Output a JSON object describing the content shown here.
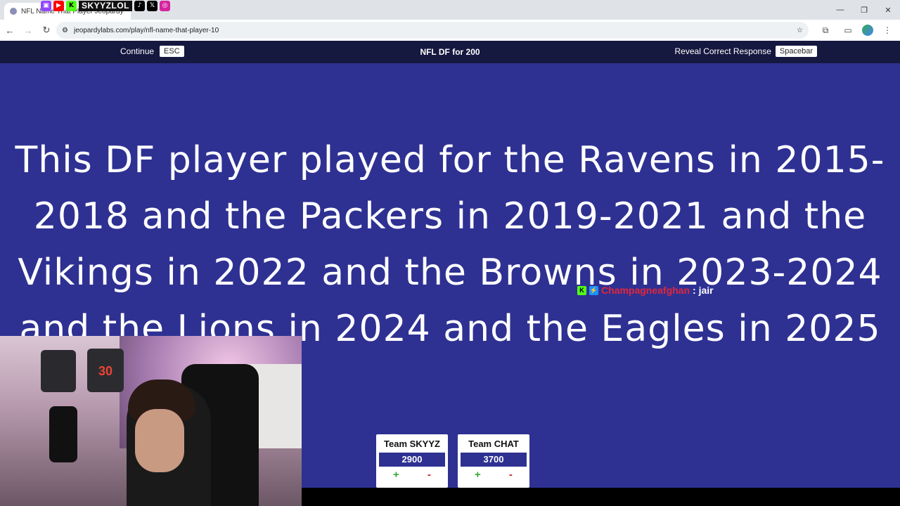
{
  "browser": {
    "tab_title": "NFL Name That Player Jeopardy",
    "url": "jeopardylabs.com/play/nfl-name-that-player-10",
    "overlay_brand": "SKYYZLOL",
    "window_controls": [
      "minimize-icon",
      "restore-icon",
      "close-icon"
    ]
  },
  "header": {
    "continue_label": "Continue",
    "continue_key": "ESC",
    "title": "NFL DF for 200",
    "reveal_label": "Reveal Correct Response",
    "reveal_key": "Spacebar"
  },
  "clue": {
    "text": "This DF player played for the Ravens in 2015-2018 and the Packers in 2019-2021 and the Vikings in 2022 and the Browns in 2023-2024 and the Lions in 2024 and the Eagles in 2025"
  },
  "chat": {
    "username": "Champagneafghan",
    "message": ": jair"
  },
  "teams": [
    {
      "name": "Team SKYYZ",
      "score": "2900",
      "plus": "+",
      "minus": "-"
    },
    {
      "name": "Team CHAT",
      "score": "3700",
      "plus": "+",
      "minus": "-"
    }
  ],
  "webcam": {
    "shirt_number": "30"
  },
  "colors": {
    "board_blue": "#2e3192",
    "header_navy": "#15183f",
    "chat_user_red": "#e3263a"
  }
}
